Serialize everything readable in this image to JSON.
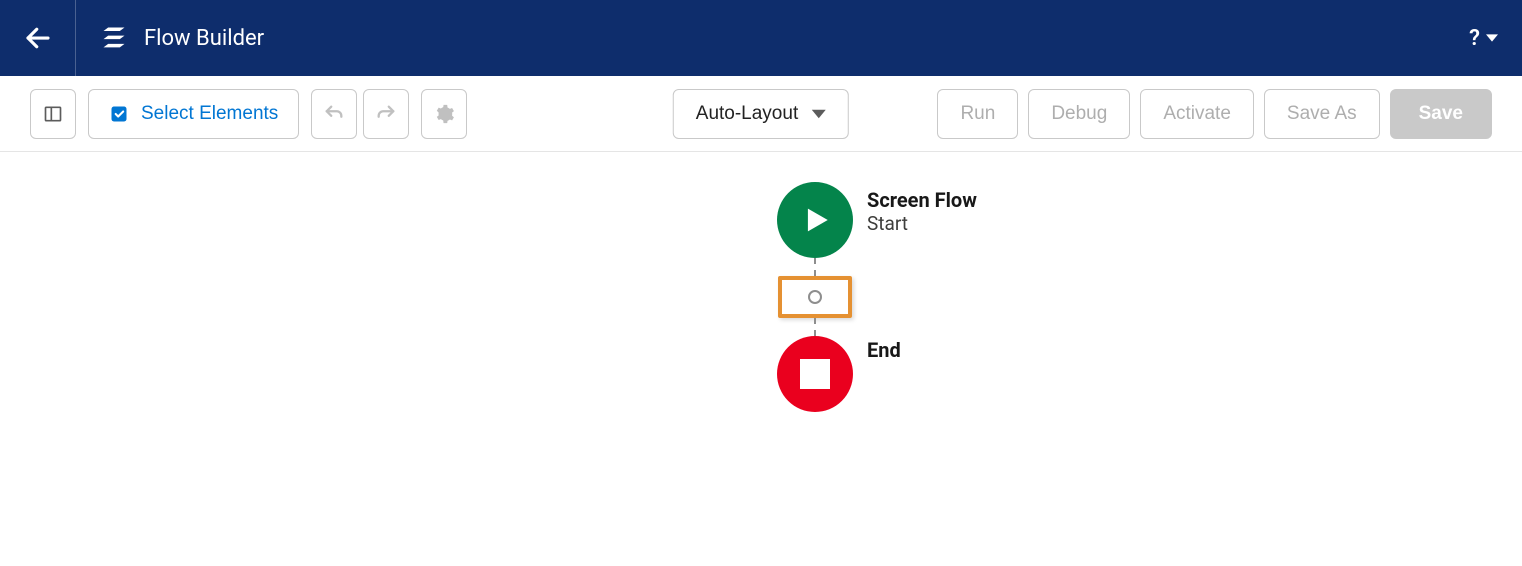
{
  "header": {
    "title": "Flow Builder"
  },
  "toolbar": {
    "select_elements_label": "Select Elements",
    "layout_label": "Auto-Layout",
    "run_label": "Run",
    "debug_label": "Debug",
    "activate_label": "Activate",
    "save_as_label": "Save As",
    "save_label": "Save"
  },
  "canvas": {
    "start": {
      "title": "Screen Flow",
      "subtitle": "Start"
    },
    "end": {
      "label": "End"
    }
  }
}
